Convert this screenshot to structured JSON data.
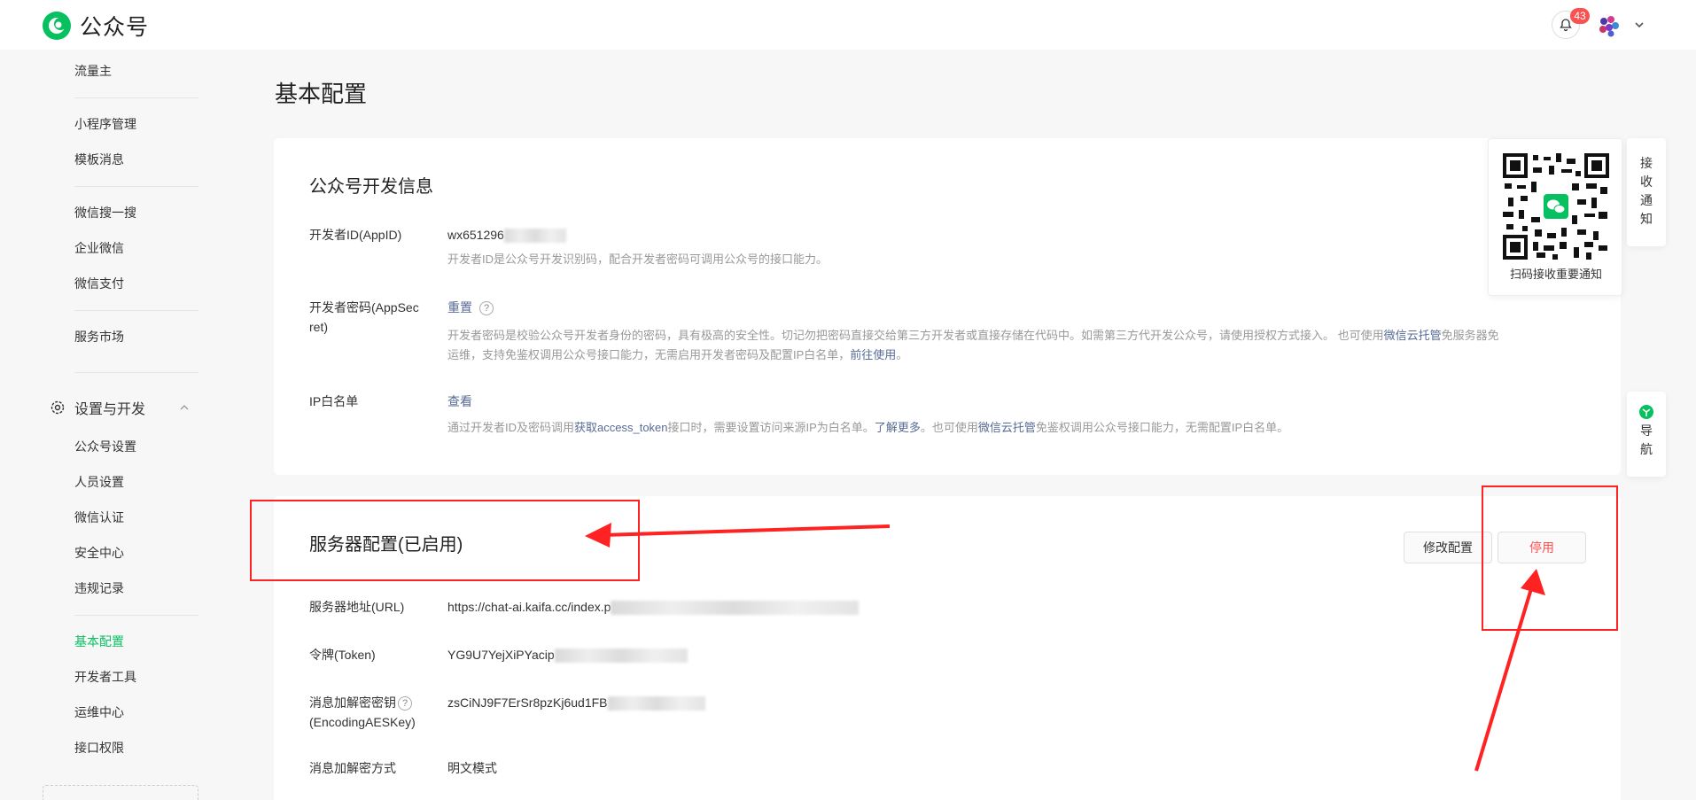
{
  "header": {
    "app_name": "公众号",
    "notification_count": "43"
  },
  "sidebar": {
    "items_top": [
      {
        "label": "流量主"
      },
      {
        "label": "小程序管理"
      },
      {
        "label": "模板消息"
      },
      {
        "label": "微信搜一搜"
      },
      {
        "label": "企业微信"
      },
      {
        "label": "微信支付"
      },
      {
        "label": "服务市场"
      }
    ],
    "group_label": "设置与开发",
    "items_group": [
      {
        "label": "公众号设置"
      },
      {
        "label": "人员设置"
      },
      {
        "label": "微信认证"
      },
      {
        "label": "安全中心"
      },
      {
        "label": "违规记录"
      },
      {
        "label": "基本配置"
      },
      {
        "label": "开发者工具"
      },
      {
        "label": "运维中心"
      },
      {
        "label": "接口权限"
      }
    ]
  },
  "main": {
    "page_title": "基本配置",
    "dev_info": {
      "title": "公众号开发信息",
      "appid_label": "开发者ID(AppID)",
      "appid_value": "wx651296",
      "appid_desc": "开发者ID是公众号开发识别码，配合开发者密码可调用公众号的接口能力。",
      "secret_label_1": "开发者密码(AppSec",
      "secret_label_2": "ret)",
      "secret_action": "重置",
      "secret_desc_a": "开发者密码是校验公众号开发者身份的密码，具有极高的安全性。切记勿把密码直接交给第三方开发者或直接存储在代码中。如需第三方代开发公众号，请使用授权方式接入。 也可使用",
      "secret_desc_link1": "微信云托管",
      "secret_desc_b": "免服务器免",
      "secret_desc_c": "运维，支持免鉴权调用公众号接口能力，无需启用开发者密码及配置IP白名单，",
      "secret_desc_link2": "前往使用",
      "secret_desc_end": "。",
      "ip_label": "IP白名单",
      "ip_action": "查看",
      "ip_desc_a": "通过开发者ID及密码调用",
      "ip_desc_link1": "获取access_token",
      "ip_desc_b": "接口时，需要设置访问来源IP为白名单。",
      "ip_desc_link2": "了解更多",
      "ip_desc_c": "。也可使用",
      "ip_desc_link3": "微信云托管",
      "ip_desc_d": "免鉴权调用公众号接口能力，无需配置IP白名单。"
    },
    "server_config": {
      "title": "服务器配置(已启用)",
      "modify_button": "修改配置",
      "stop_button": "停用",
      "url_label": "服务器地址(URL)",
      "url_value": "https://chat-ai.kaifa.cc/index.p",
      "token_label": "令牌(Token)",
      "token_value": "YG9U7YejXiPYacip",
      "aes_label_1": "消息加解密密钥",
      "aes_label_2": "(EncodingAESKey)",
      "aes_value": "zsCiNJ9F7ErSr8pzKj6ud1FB",
      "mode_label": "消息加解密方式",
      "mode_value": "明文模式"
    }
  },
  "float_panel": {
    "qr_caption": "扫码接收重要通知",
    "receive_tab": [
      "接",
      "收",
      "通",
      "知"
    ],
    "nav_tab": [
      "导",
      "航"
    ]
  },
  "colors": {
    "accent_green": "#07c160",
    "link": "#576b95",
    "danger": "#fa5151",
    "annotation_red": "#ff2222"
  }
}
